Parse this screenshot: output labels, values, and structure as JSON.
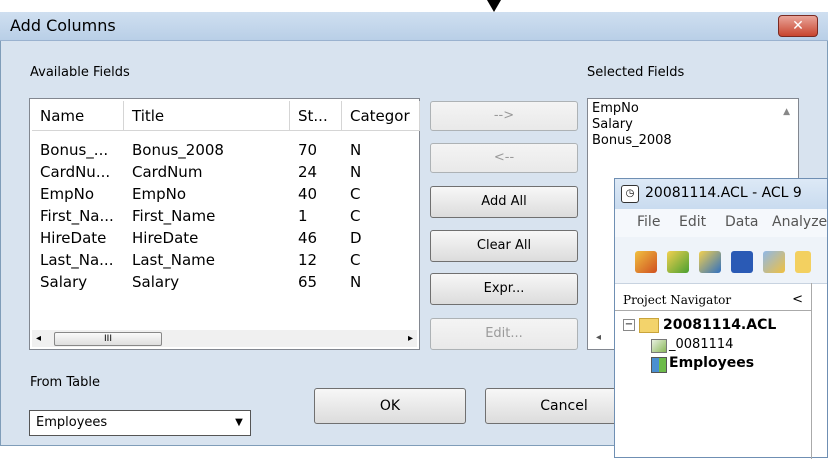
{
  "dialog": {
    "title": "Add Columns",
    "close_label": "✕",
    "available_label": "Available Fields",
    "selected_label": "Selected Fields",
    "from_table_label": "From Table"
  },
  "available": {
    "columns": [
      "Name",
      "Title",
      "St...",
      "Categor"
    ],
    "rows": [
      [
        "Bonus_...",
        "Bonus_2008",
        "70",
        "N"
      ],
      [
        "CardNu...",
        "CardNum",
        "24",
        "N"
      ],
      [
        "EmpNo",
        "EmpNo",
        "40",
        "C"
      ],
      [
        "First_Na...",
        "First_Name",
        "1",
        "C"
      ],
      [
        "HireDate",
        "HireDate",
        "46",
        "D"
      ],
      [
        "Last_Na...",
        "Last_Name",
        "12",
        "C"
      ],
      [
        "Salary",
        "Salary",
        "65",
        "N"
      ]
    ],
    "scroll_thumb_label": "III"
  },
  "buttons": {
    "add": "-->",
    "remove": "<--",
    "add_all": "Add All",
    "clear_all": "Clear All",
    "expr": "Expr...",
    "edit": "Edit...",
    "ok": "OK",
    "cancel": "Cancel"
  },
  "selected": {
    "items": [
      "EmpNo",
      "Salary",
      "Bonus_2008"
    ]
  },
  "from_table": {
    "value": "Employees"
  },
  "acl": {
    "title": "20081114.ACL - ACL 9",
    "menu": [
      "File",
      "Edit",
      "Data",
      "Analyze"
    ],
    "navigator_label": "Project Navigator",
    "navigator_collapse": "<",
    "tree": {
      "project": "20081114.ACL",
      "item1": "_0081114",
      "item2": "Employees"
    }
  },
  "icons": [
    "close-icon",
    "scroll-left-icon",
    "scroll-right-icon",
    "dropdown-arrow-icon",
    "folder-icon",
    "script-icon",
    "table-icon",
    "app-icon"
  ]
}
